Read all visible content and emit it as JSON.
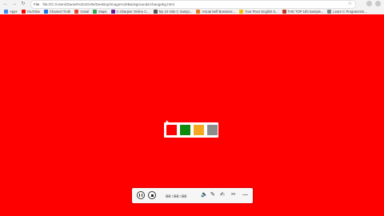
{
  "browser": {
    "url": "file:///C:/Users/Daniel%20JOHN/Desktop/Image%20Backgrounds/changebg.html",
    "url_label": "File",
    "bookmarks": [
      {
        "label": "Apps",
        "icon": "apps-icon",
        "color": "#4285f4"
      },
      {
        "label": "YouTube",
        "icon": "youtube-icon",
        "color": "#ff0000"
      },
      {
        "label": "Channel Truth",
        "icon": "channel-icon",
        "color": "#1a73e8"
      },
      {
        "label": "Gmail",
        "icon": "gmail-icon",
        "color": "#ea4335"
      },
      {
        "label": "Maps",
        "icon": "maps-icon",
        "color": "#34a853"
      },
      {
        "label": "C-Sharpier Online C...",
        "icon": "csharp-icon",
        "color": "#6a1b9a"
      },
      {
        "label": "My 10 Vids C Sampr...",
        "icon": "video-icon",
        "color": "#555555"
      },
      {
        "label": "Actual Self Business...",
        "icon": "business-icon",
        "color": "#e67e22"
      },
      {
        "label": "Your Pace English S...",
        "icon": "english-icon",
        "color": "#f1c40f"
      },
      {
        "label": "THE TOP 100 Sample...",
        "icon": "top100-icon",
        "color": "#c0392b"
      },
      {
        "label": "Learn C Programmin...",
        "icon": "learn-c-icon",
        "color": "#7f8c8d"
      }
    ]
  },
  "page": {
    "background": "#ff0000",
    "swatches": [
      {
        "name": "red-swatch",
        "color": "#ff0000"
      },
      {
        "name": "green-swatch",
        "color": "#0f8a0f"
      },
      {
        "name": "orange-swatch",
        "color": "#f4a820"
      },
      {
        "name": "gray-swatch",
        "color": "#8c8c8c"
      }
    ]
  },
  "recorder": {
    "time": "00:00:06",
    "icons": [
      "pause-icon",
      "stop-icon",
      "volume-icon",
      "pen-icon",
      "highlighter-icon",
      "crop-icon",
      "minimize-icon"
    ]
  }
}
